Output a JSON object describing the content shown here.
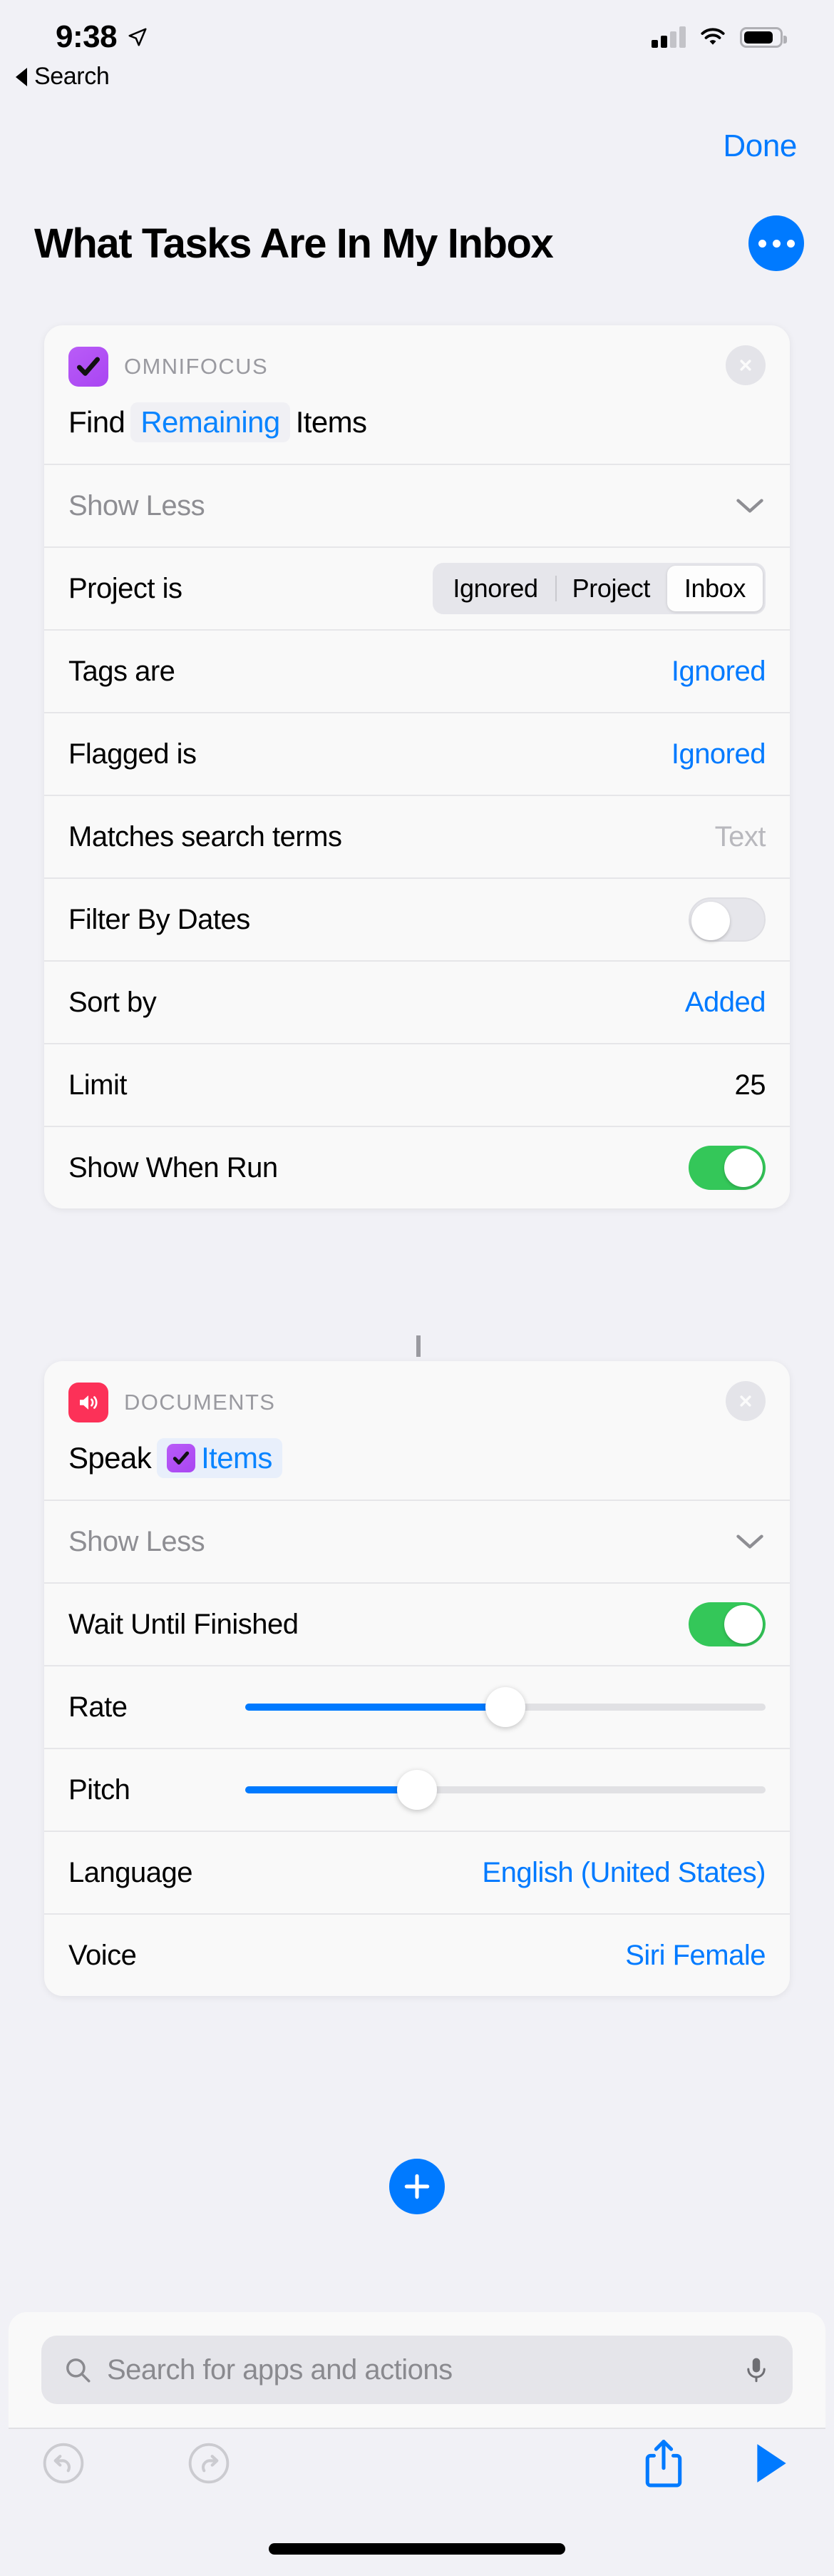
{
  "status_bar": {
    "time": "9:38",
    "location_icon": "location-arrow-icon",
    "cellular_icon": "cellular-signal-icon",
    "wifi_icon": "wifi-icon",
    "battery_icon": "battery-icon"
  },
  "back": {
    "label": "Search",
    "icon": "back-triangle-icon"
  },
  "nav": {
    "done_label": "Done"
  },
  "header": {
    "title": "What Tasks Are In My Inbox",
    "more_icon": "ellipsis-icon"
  },
  "actions": [
    {
      "app_name": "OMNIFOCUS",
      "app_icon": "checkmark-icon",
      "close_icon": "close-x-icon",
      "title_parts": [
        {
          "text": "Find",
          "type": "word"
        },
        {
          "text": "Remaining",
          "type": "token"
        },
        {
          "text": "Items",
          "type": "word"
        }
      ],
      "disclosure": {
        "label": "Show Less",
        "icon": "chevron-down-icon"
      },
      "rows": [
        {
          "label": "Project is",
          "type": "segmented",
          "options": [
            "Ignored",
            "Project",
            "Inbox"
          ],
          "selected": "Inbox"
        },
        {
          "label": "Tags are",
          "type": "value",
          "value": "Ignored",
          "value_color": "blue"
        },
        {
          "label": "Flagged is",
          "type": "value",
          "value": "Ignored",
          "value_color": "blue"
        },
        {
          "label": "Matches search terms",
          "type": "placeholder",
          "value": "Text",
          "value_color": "gray"
        },
        {
          "label": "Filter By Dates",
          "type": "toggle",
          "state": "off"
        },
        {
          "label": "Sort by",
          "type": "value",
          "value": "Added",
          "value_color": "blue"
        },
        {
          "label": "Limit",
          "type": "value",
          "value": "25",
          "value_color": "black"
        },
        {
          "label": "Show When Run",
          "type": "toggle",
          "state": "on"
        }
      ]
    },
    {
      "app_name": "DOCUMENTS",
      "app_icon": "speaker-wave-icon",
      "close_icon": "close-x-icon",
      "title_parts": [
        {
          "text": "Speak",
          "type": "word"
        },
        {
          "text": "Items",
          "type": "token-with-icon"
        }
      ],
      "disclosure": {
        "label": "Show Less",
        "icon": "chevron-down-icon"
      },
      "rows": [
        {
          "label": "Wait Until Finished",
          "type": "toggle",
          "state": "on"
        },
        {
          "label": "Rate",
          "type": "slider",
          "percent": 50
        },
        {
          "label": "Pitch",
          "type": "slider",
          "percent": 33
        },
        {
          "label": "Language",
          "type": "value",
          "value": "English (United States)",
          "value_color": "blue"
        },
        {
          "label": "Voice",
          "type": "value",
          "value": "Siri Female",
          "value_color": "blue"
        }
      ]
    }
  ],
  "add_button": {
    "icon": "plus-icon"
  },
  "search": {
    "placeholder": "Search for apps and actions",
    "search_icon": "search-icon",
    "mic_icon": "microphone-icon"
  },
  "toolbar": {
    "undo_icon": "undo-icon",
    "redo_icon": "redo-icon",
    "share_icon": "share-icon",
    "run_icon": "play-icon"
  },
  "colors": {
    "accent_blue": "#007AFF",
    "toggle_green": "#34C759",
    "omnifocus_purple": "#A945F2",
    "documents_red": "#FC3158",
    "page_background": "#F1F1F6",
    "card_background": "#F9F9F9"
  }
}
